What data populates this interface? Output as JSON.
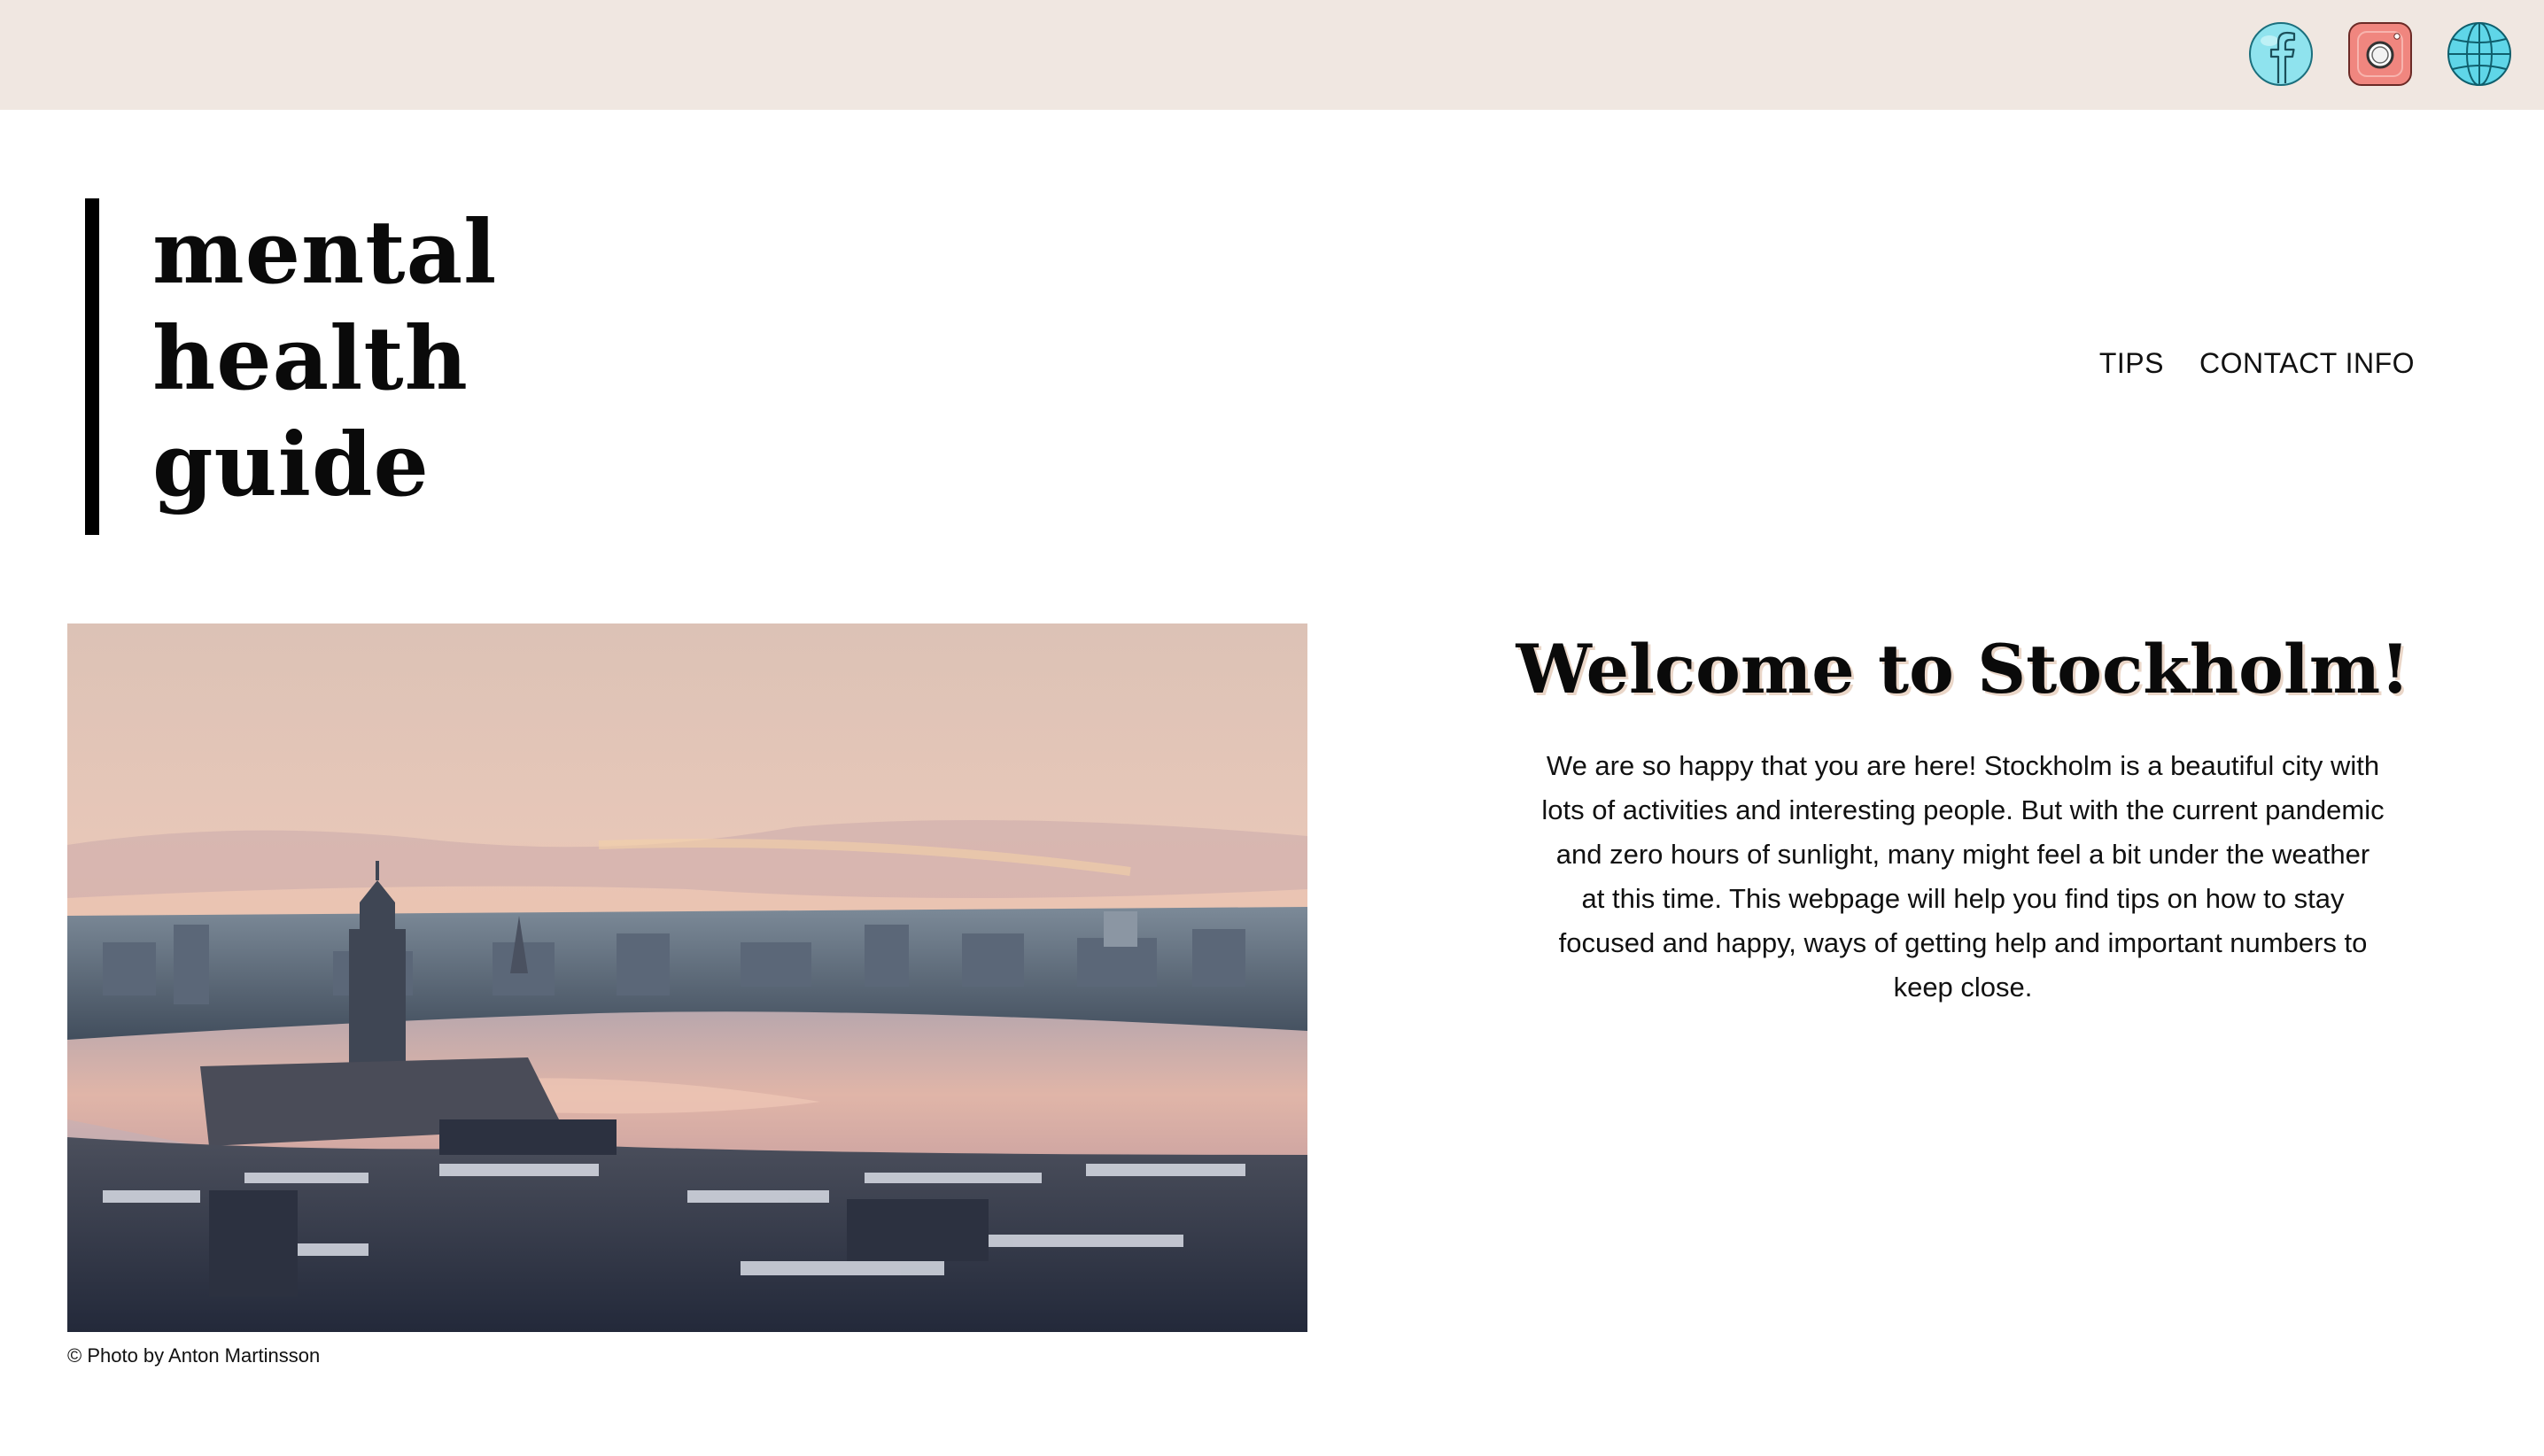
{
  "header": {
    "social_links": [
      {
        "icon": "facebook-icon",
        "color": "#8fe3ee"
      },
      {
        "icon": "instagram-icon",
        "color": "#f0867f"
      },
      {
        "icon": "globe-icon",
        "color": "#5fd6e8"
      }
    ],
    "background": "#f0e7e1"
  },
  "logo": {
    "line1": "mental",
    "line2": "health",
    "line3": "guide"
  },
  "nav": {
    "tips": "TIPS",
    "contact": "CONTACT INFO"
  },
  "hero": {
    "image_description_icon": "city-photo",
    "caption": "© Photo by Anton Martinsson"
  },
  "main": {
    "title": "Welcome to Stockholm!",
    "body": "We are so happy that you are here! Stockholm is a beautiful city with lots of activities and interesting people. But with the current pandemic and zero hours of sunlight, many might feel a bit under the weather at this time. This webpage will help you find tips on how to stay focused and happy, ways of getting help and important numbers to keep close."
  },
  "colors": {
    "title_shadow": "#ead6c8",
    "text": "#111111"
  }
}
